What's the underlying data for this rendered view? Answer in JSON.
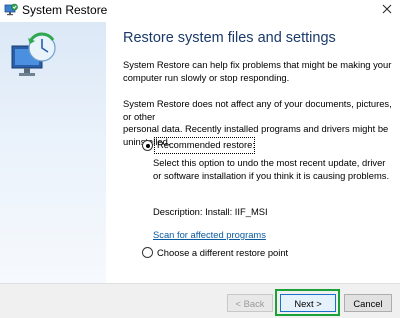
{
  "window": {
    "title": "System Restore"
  },
  "icons": {
    "app": "system-restore-icon",
    "close": "close-icon",
    "illustration": "restore-computer-illustration"
  },
  "content": {
    "heading": "Restore system files and settings",
    "para1_line1": "System Restore can help fix problems that might be making your",
    "para1_line2": "computer run slowly or stop responding.",
    "para2_line1": "System Restore does not affect any of your documents, pictures, or other",
    "para2_line2": "personal data. Recently installed programs and drivers might be",
    "para2_line3": "uninstalled.",
    "recommended_label": "Recommended restore:",
    "recommended_desc_line1": "Select this option to undo the most recent update, driver",
    "recommended_desc_line2": "or software installation if you think it is causing problems.",
    "description": "Description:  Install: IIF_MSI",
    "scan_link": "Scan for affected programs",
    "choose_label": "Choose a different restore point"
  },
  "footer": {
    "back": "< Back",
    "next": "Next >",
    "cancel": "Cancel"
  },
  "colors": {
    "highlight": "#1aa236",
    "accent": "#1e6fc8",
    "link": "#0a5aa0"
  }
}
